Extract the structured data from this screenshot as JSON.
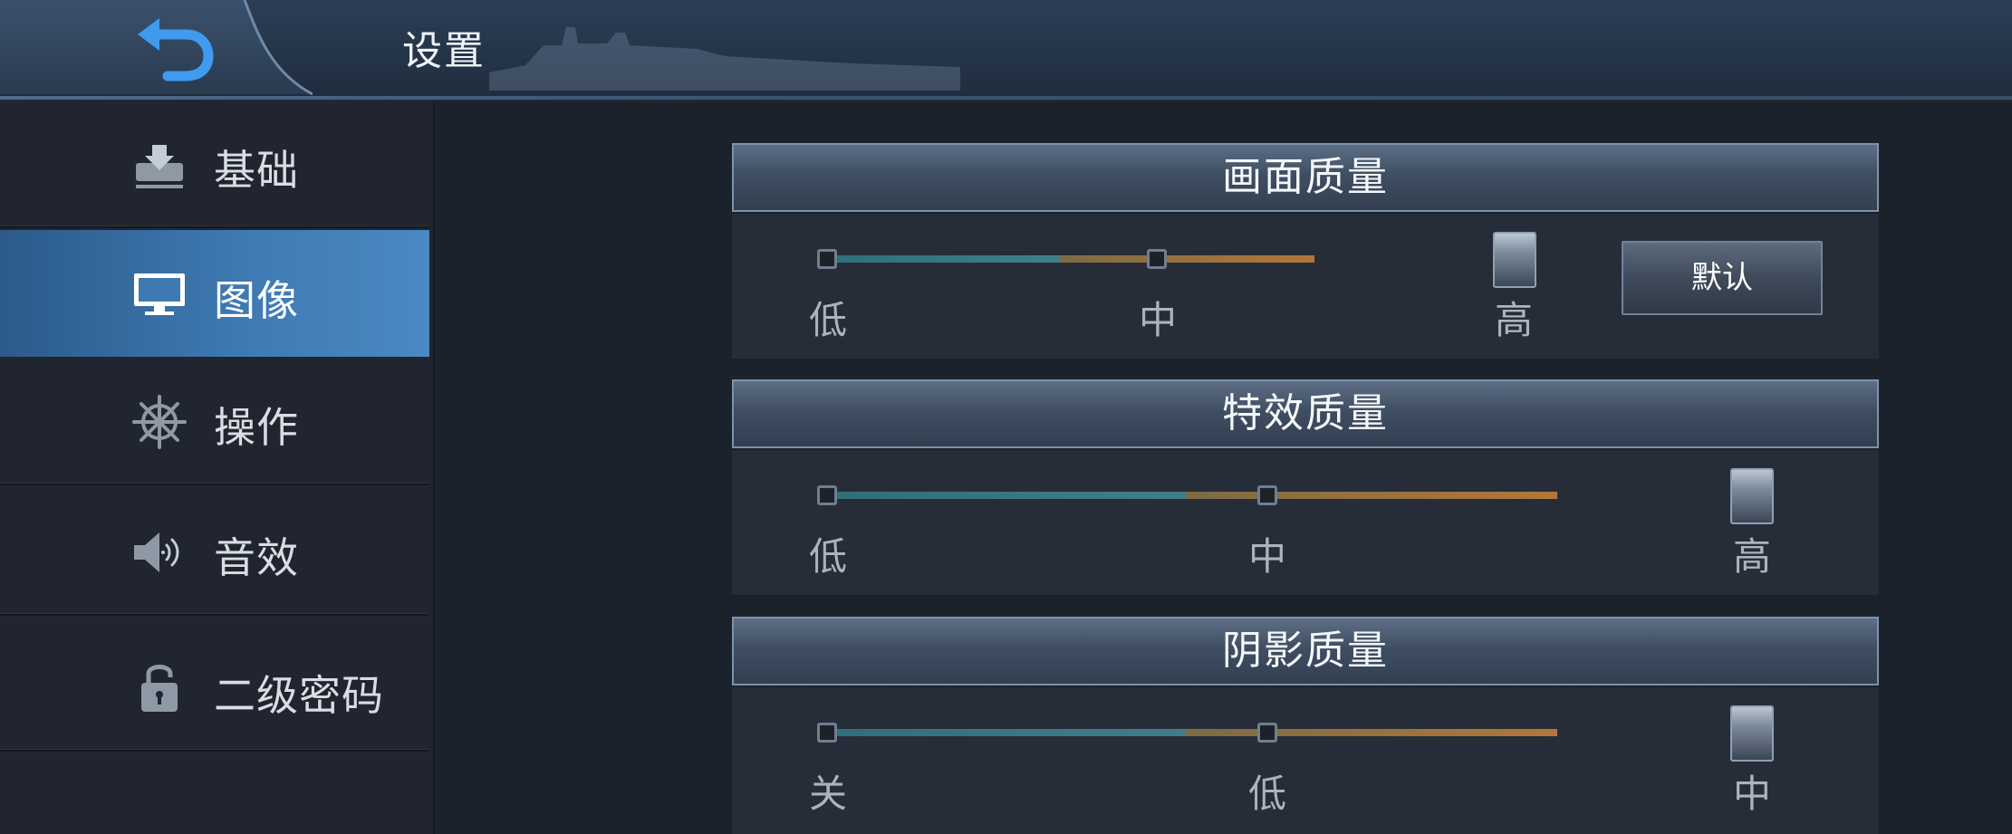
{
  "header": {
    "title": "设置",
    "back_icon": "back-arrow-icon"
  },
  "colors": {
    "active_tab": "#3e79b2",
    "track_low": "#3f7f8a",
    "track_high": "#b2773a",
    "header_bg": "#2c3d55"
  },
  "sidebar": {
    "items": [
      {
        "label": "基础",
        "icon": "inbox-icon",
        "active": false
      },
      {
        "label": "图像",
        "icon": "monitor-icon",
        "active": true
      },
      {
        "label": "操作",
        "icon": "ship-wheel-icon",
        "active": false
      },
      {
        "label": "音效",
        "icon": "speaker-icon",
        "active": false
      },
      {
        "label": "二级密码",
        "icon": "lock-icon",
        "active": false
      }
    ]
  },
  "settings": [
    {
      "title": "画面质量",
      "options": [
        "低",
        "中",
        "高"
      ],
      "selected": "高",
      "default_button": "默认"
    },
    {
      "title": "特效质量",
      "options": [
        "低",
        "中",
        "高"
      ],
      "selected": "高"
    },
    {
      "title": "阴影质量",
      "options": [
        "关",
        "低",
        "中"
      ],
      "selected": "中"
    }
  ]
}
